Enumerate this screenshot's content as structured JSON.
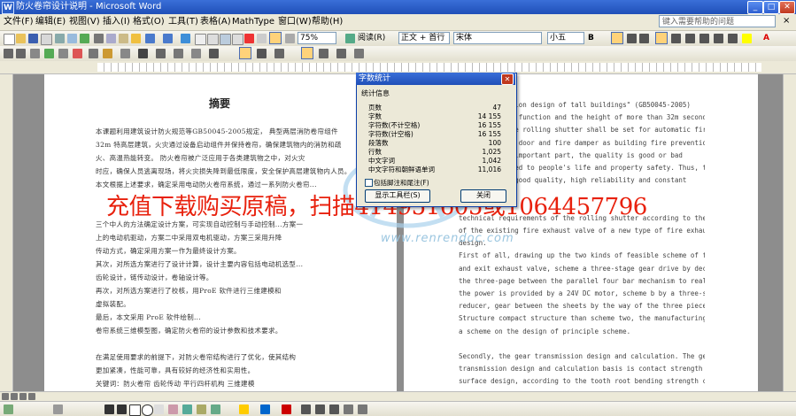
{
  "window": {
    "title": "防火卷帘设计说明 - Microsoft Word",
    "min_label": "_",
    "max_label": "□",
    "close_label": "✕"
  },
  "menu": {
    "items": [
      "文件(F)",
      "编辑(E)",
      "视图(V)",
      "插入(I)",
      "格式(O)",
      "工具(T)",
      "表格(A)",
      "MathType",
      "窗口(W)",
      "帮助(H)"
    ],
    "help_placeholder": "键入需要帮助的问题",
    "close_doc": "×"
  },
  "toolbar": {
    "zoom": "75%",
    "read_label": "阅读(R)",
    "style": "正文 + 首行",
    "font": "宋体",
    "size": "小五",
    "bold": "B",
    "font_color": "A"
  },
  "document": {
    "abstract_heading": "摘要",
    "left_lines": [
      "本课题利用建筑设计防火规范等GB50045-2005规定，   典型两层消防卷帘组件",
      "32m 特高层建筑，火灾通过设备启动组件并保持卷帘，确保建筑物内的消防和疏",
      "火、高温热能转变。   防火卷帘被广泛应用于各类建筑物之中，对火灾",
      "时应，确保人员逃离现场，将火灾损失降到最低限度，安全保护高层建筑物内人员。",
      "本文根据上述要求，确定采用电动防火卷帘系统，通过一系列防火卷帘...",
      "",
      "",
      "三个中人的方法确定设计方案，可实现自动控制与手动控制...方案一",
      "上的电动机驱动，方案二中采用双电机驱动，方案三采用升降",
      "  传动方式，确定采用方案一作为最终设计方案。",
      "   其次，对所选方案进行了设计计算，设计主要内容包括电动机选型...",
      "   齿轮设计，链传动设计，卷轴设计等。",
      "   再次，对所选方案进行了校核，用ProE 软件进行三维建模和",
      "  虚拟装配。",
      "   最后，本文采用 ProE 软件绘制...",
      "   卷帘系统三维模型图，确定防火卷帘的设计参数和技术要求。",
      "",
      "   在满足使用要求的前提下，对防火卷帘结构进行了优化，使其结构",
      "   更加紧凑，性能可靠，具有较好的经济性和实用性。",
      "   关键词：防火卷帘  齿轮传动  平行四杆机构  三维建模"
    ],
    "right_lines": [
      "   ...the protection design of tall buildings\" (GB50045-2005)",
      "stipulates the function and the height of more than 32m second building",
      "fire resistance rolling shutter shall be set for automatic fire prevention",
      "a rolling fire door and fire damper as building fire prevention.  Rolling",
      "shutter is an important part,  the quality is good or bad",
      "directly related to people's life and property safety. Thus, the smoke",
      "fire door has good quality,  high reliability and constant",
      "",
      "",
      "technical requirements of the rolling shutter according to the characteristics",
      "of the existing fire exhaust valve of a new type of fire exhaust valve",
      "design.",
      "   First of all, drawing up the two kinds of feasible scheme of fire shutter",
      "and exit exhaust valve, scheme a three-stage gear drive by deceleration,",
      "the three-page between the parallel four bar mechanism to realize linkage,",
      "the power is provided by a 24V DC motor, scheme b by a three-stage gear",
      "reducer, gear between the sheets by the way of the three pieces of linkage.",
      "Structure compact structure than scheme two, the manufacturing cost is lower,",
      "a scheme on the design of principle scheme.",
      "",
      "   Secondly, the gear transmission design and calculation. The gear",
      "transmission design and calculation basis is contact strength of tooth",
      "surface design, according to the tooth root bending strength check."
    ]
  },
  "watermark": {
    "text": "充值下载购买原稿，扫描414951605或1064457796",
    "site": "www.renrendoc.com"
  },
  "dialog": {
    "title": "字数统计",
    "section": "统计信息",
    "stats": [
      {
        "label": "页数",
        "value": "47"
      },
      {
        "label": "字数",
        "value": "14 155"
      },
      {
        "label": "字符数(不计空格)",
        "value": "16 155"
      },
      {
        "label": "字符数(计空格)",
        "value": "16 155"
      },
      {
        "label": "段落数",
        "value": "100"
      },
      {
        "label": "行数",
        "value": "1,025"
      },
      {
        "label": "中文字词",
        "value": "1,042"
      },
      {
        "label": "中文字符和朝鲜语单词",
        "value": "11,016"
      }
    ],
    "checkbox_label": "包括脚注和尾注(F)",
    "toolbar_button": "显示工具栏(S)",
    "close_button": "关闭"
  }
}
